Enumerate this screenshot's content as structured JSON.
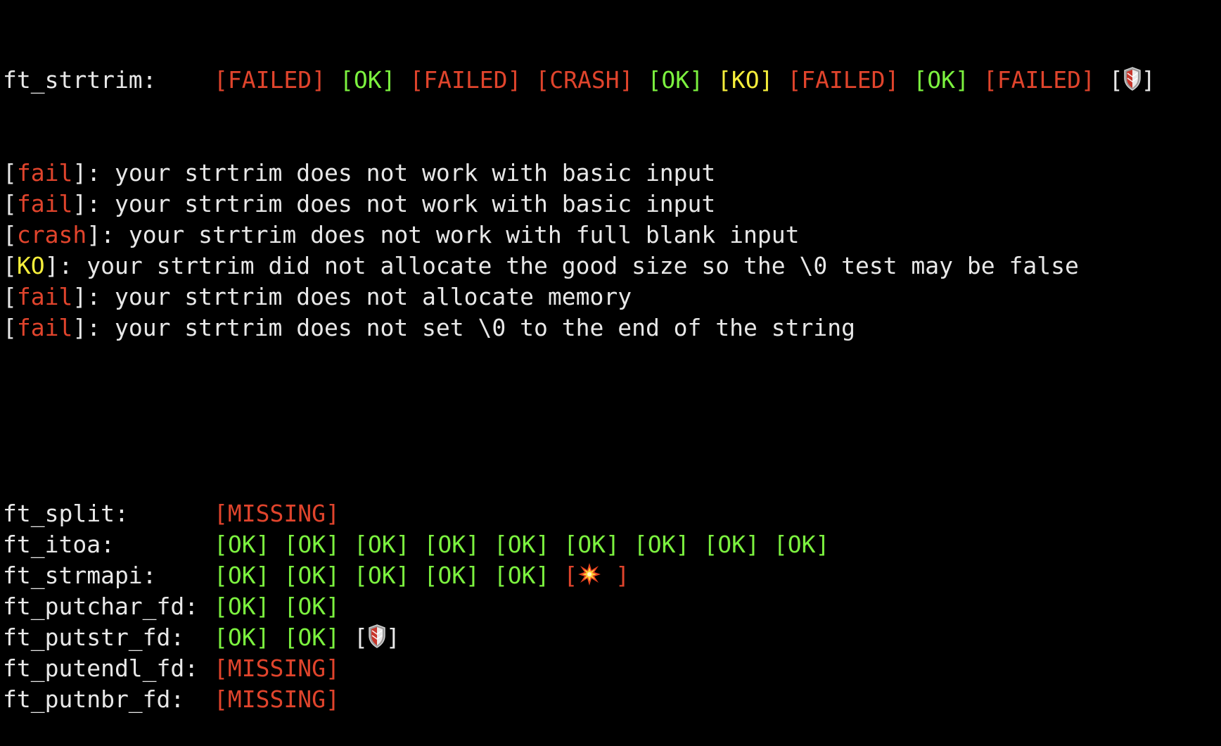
{
  "colors": {
    "background": "#000000",
    "text": "#e8e8e8",
    "fail": "#e0442c",
    "ok": "#7cf23f",
    "ko": "#f5ee3b"
  },
  "results": [
    {
      "label": "ft_strtrim:",
      "tokens": [
        {
          "text": "[FAILED]",
          "status": "red"
        },
        {
          "text": "[OK]",
          "status": "green"
        },
        {
          "text": "[FAILED]",
          "status": "red"
        },
        {
          "text": "[CRASH]",
          "status": "red"
        },
        {
          "text": "[OK]",
          "status": "green"
        },
        {
          "text": "[KO]",
          "status": "yellow"
        },
        {
          "text": "[FAILED]",
          "status": "red"
        },
        {
          "text": "[OK]",
          "status": "green"
        },
        {
          "text": "[FAILED]",
          "status": "red"
        },
        {
          "icon": "shield-icon",
          "status": "default"
        }
      ]
    }
  ],
  "messages": [
    {
      "tag": "fail",
      "tag_status": "red",
      "text": ": your strtrim does not work with basic input"
    },
    {
      "tag": "fail",
      "tag_status": "red",
      "text": ": your strtrim does not work with basic input"
    },
    {
      "tag": "crash",
      "tag_status": "red",
      "text": ": your strtrim does not work with full blank input"
    },
    {
      "tag": "KO",
      "tag_status": "yellow",
      "text": ": your strtrim did not allocate the good size so the \\0 test may be false"
    },
    {
      "tag": "fail",
      "tag_status": "red",
      "text": ": your strtrim does not allocate memory"
    },
    {
      "tag": "fail",
      "tag_status": "red",
      "text": ": your strtrim does not set \\0 to the end of the string"
    }
  ],
  "results2": [
    {
      "label": "ft_split:",
      "tokens": [
        {
          "text": "[MISSING]",
          "status": "red"
        }
      ]
    },
    {
      "label": "ft_itoa:",
      "tokens": [
        {
          "text": "[OK]",
          "status": "green"
        },
        {
          "text": "[OK]",
          "status": "green"
        },
        {
          "text": "[OK]",
          "status": "green"
        },
        {
          "text": "[OK]",
          "status": "green"
        },
        {
          "text": "[OK]",
          "status": "green"
        },
        {
          "text": "[OK]",
          "status": "green"
        },
        {
          "text": "[OK]",
          "status": "green"
        },
        {
          "text": "[OK]",
          "status": "green"
        },
        {
          "text": "[OK]",
          "status": "green"
        }
      ]
    },
    {
      "label": "ft_strmapi:",
      "tokens": [
        {
          "text": "[OK]",
          "status": "green"
        },
        {
          "text": "[OK]",
          "status": "green"
        },
        {
          "text": "[OK]",
          "status": "green"
        },
        {
          "text": "[OK]",
          "status": "green"
        },
        {
          "text": "[OK]",
          "status": "green"
        },
        {
          "icon": "explosion-icon",
          "status": "red"
        }
      ]
    },
    {
      "label": "ft_putchar_fd:",
      "tokens": [
        {
          "text": "[OK]",
          "status": "green"
        },
        {
          "text": "[OK]",
          "status": "green"
        }
      ]
    },
    {
      "label": "ft_putstr_fd:",
      "tokens": [
        {
          "text": "[OK]",
          "status": "green"
        },
        {
          "text": "[OK]",
          "status": "green"
        },
        {
          "icon": "shield-icon",
          "status": "default"
        }
      ]
    },
    {
      "label": "ft_putendl_fd:",
      "tokens": [
        {
          "text": "[MISSING]",
          "status": "red"
        }
      ]
    },
    {
      "label": "ft_putnbr_fd:",
      "tokens": [
        {
          "text": "[MISSING]",
          "status": "red"
        }
      ]
    }
  ]
}
